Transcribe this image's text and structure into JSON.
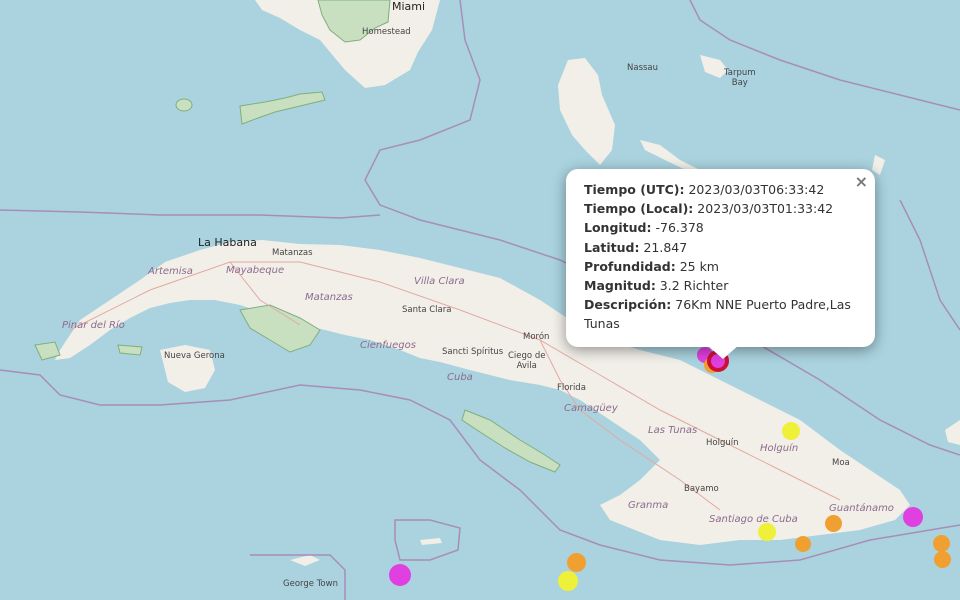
{
  "places": {
    "miami": "Miami",
    "homestead": "Homestead",
    "nassau": "Nassau",
    "tarpum_bay": "Tarpum\nBay",
    "la_habana": "La Habana",
    "matanzas_city": "Matanzas",
    "artemisa": "Artemisa",
    "mayabeque": "Mayabeque",
    "matanzas_prov": "Matanzas",
    "villa_clara": "Villa Clara",
    "santa_clara": "Santa Clara",
    "pinar_del_rio": "Pinar del Río",
    "nueva_gerona": "Nueva Gerona",
    "cienfuegos": "Cienfuegos",
    "sancti_spiritus": "Sancti Spíritus",
    "ciego_de_avila": "Ciego de\nAvila",
    "moron": "Morón",
    "cuba": "Cuba",
    "florida": "Florida",
    "camaguey": "Camagüey",
    "las_tunas": "Las Tunas",
    "holguin_city": "Holguín",
    "holguin_prov": "Holguín",
    "moa": "Moa",
    "bayamo": "Bayamo",
    "granma": "Granma",
    "santiago": "Santiago de Cuba",
    "guantanamo": "Guantánamo",
    "george_town": "George Town"
  },
  "popup": {
    "close_label": "×",
    "rows": [
      {
        "label": "Tiempo (UTC):",
        "value": " 2023/03/03T06:33:42"
      },
      {
        "label": "Tiempo (Local):",
        "value": " 2023/03/03T01:33:42"
      },
      {
        "label": "Longitud:",
        "value": " -76.378"
      },
      {
        "label": "Latitud:",
        "value": " 21.847"
      },
      {
        "label": "Profundidad:",
        "value": " 25 km"
      },
      {
        "label": "Magnitud:",
        "value": " 3.2 Richter"
      },
      {
        "label": "Descripción:",
        "value": " 76Km NNE Puerto Padre,Las Tunas"
      }
    ]
  },
  "colors": {
    "sea": "#aad3df",
    "land": "#f2efe9",
    "park": "#c8e0c0",
    "border": "#a88db8",
    "quake_magenta": "#e040e0",
    "quake_yellow": "#eef03a",
    "quake_orange": "#f0a030",
    "quake_red": "#cc1133"
  }
}
